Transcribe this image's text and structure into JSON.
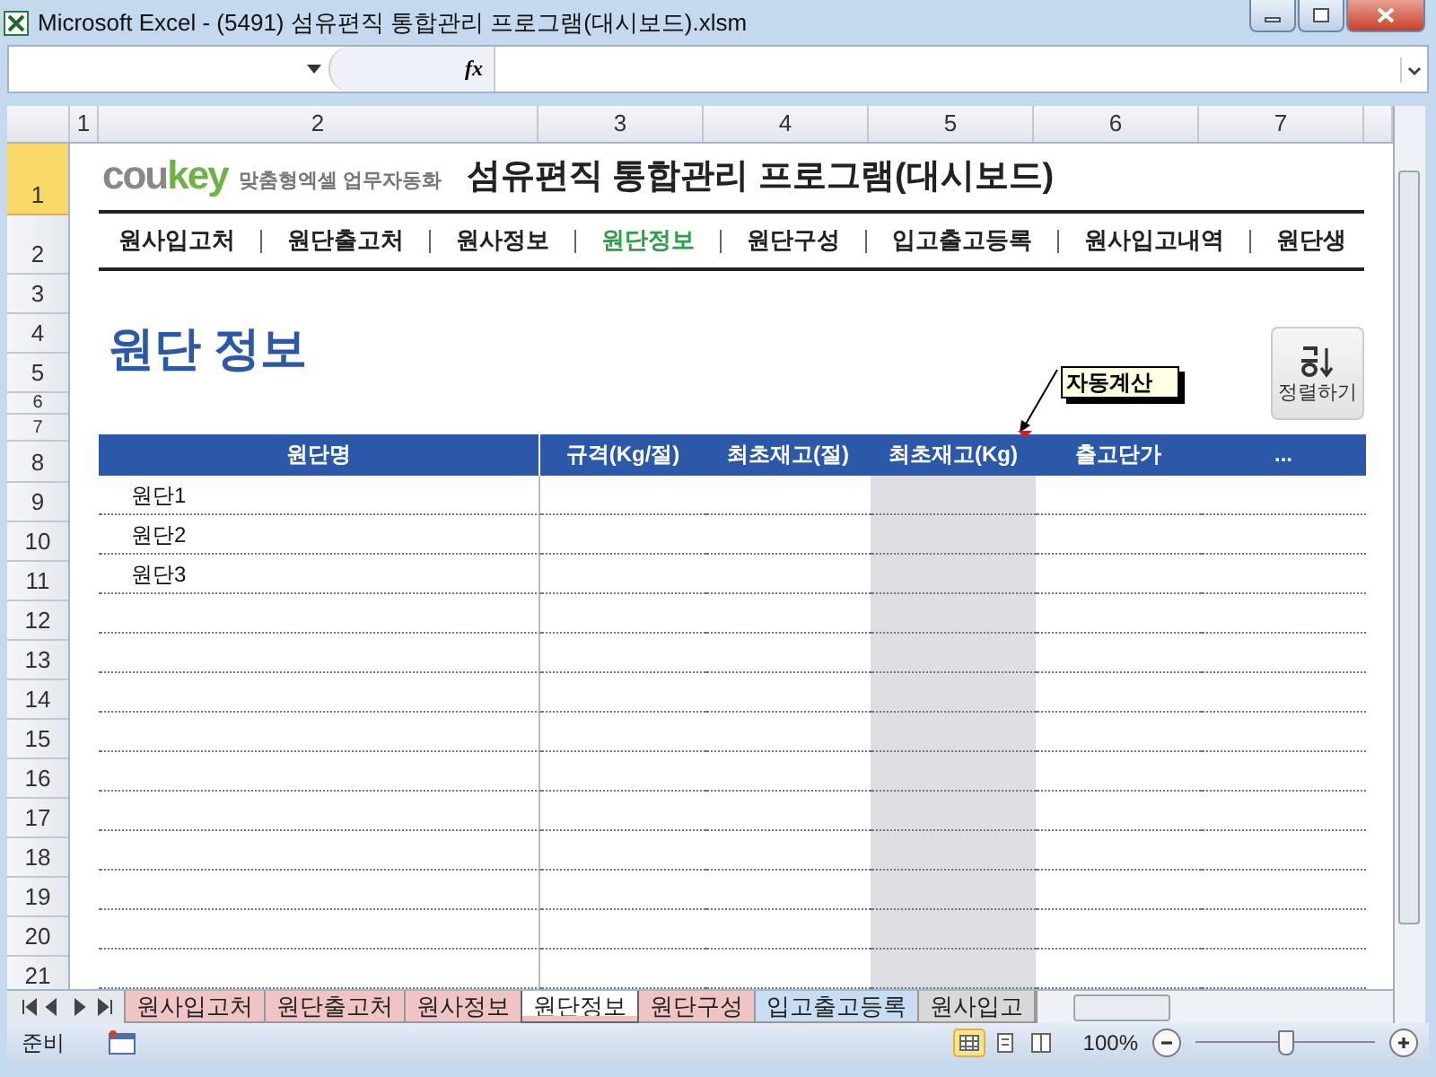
{
  "window": {
    "title": "Microsoft Excel - (5491) 섬유편직 통합관리 프로그램(대시보드).xlsm"
  },
  "formula_bar": {
    "fx": "fx"
  },
  "column_headers": [
    "1",
    "2",
    "3",
    "4",
    "5",
    "6",
    "7"
  ],
  "row_headers": [
    {
      "label": "1",
      "selected": true
    },
    {
      "label": "2",
      "selected": false
    },
    {
      "label": "3",
      "selected": false
    },
    {
      "label": "4",
      "selected": false
    },
    {
      "label": "5",
      "selected": false
    },
    {
      "label": "6",
      "selected": false
    },
    {
      "label": "7",
      "selected": false
    },
    {
      "label": "8",
      "selected": false
    },
    {
      "label": "9",
      "selected": false
    },
    {
      "label": "10",
      "selected": false
    },
    {
      "label": "11",
      "selected": false
    },
    {
      "label": "12",
      "selected": false
    },
    {
      "label": "13",
      "selected": false
    },
    {
      "label": "14",
      "selected": false
    },
    {
      "label": "15",
      "selected": false
    },
    {
      "label": "16",
      "selected": false
    },
    {
      "label": "17",
      "selected": false
    },
    {
      "label": "18",
      "selected": false
    },
    {
      "label": "19",
      "selected": false
    },
    {
      "label": "20",
      "selected": false
    },
    {
      "label": "21",
      "selected": false
    }
  ],
  "brand": {
    "logo_grey": "cou",
    "logo_green": "key",
    "tagline": "맞춤형엑셀 업무자동화",
    "title": "섬유편직 통합관리 프로그램(대시보드)"
  },
  "nav": [
    {
      "label": "원사입고처",
      "selected": false
    },
    {
      "label": "원단출고처",
      "selected": false
    },
    {
      "label": "원사정보",
      "selected": false
    },
    {
      "label": "원단정보",
      "selected": true
    },
    {
      "label": "원단구성",
      "selected": false
    },
    {
      "label": "입고출고등록",
      "selected": false
    },
    {
      "label": "원사입고내역",
      "selected": false
    },
    {
      "label": "원단생",
      "selected": false
    }
  ],
  "page_title": "원단 정보",
  "sort_button": {
    "label": "정렬하기"
  },
  "comment": "자동계산",
  "table": {
    "columns": [
      {
        "label": "원단명",
        "computed": false
      },
      {
        "label": "규격(Kg/절)",
        "computed": false
      },
      {
        "label": "최초재고(절)",
        "computed": false
      },
      {
        "label": "최초재고(Kg)",
        "computed": true
      },
      {
        "label": "출고단가",
        "computed": false
      },
      {
        "label": "...",
        "computed": false
      }
    ],
    "rows": [
      "원단1",
      "원단2",
      "원단3",
      "",
      "",
      "",
      "",
      "",
      "",
      "",
      "",
      "",
      ""
    ]
  },
  "sheet_tabs": [
    {
      "label": "원사입고처",
      "color": "#f0c4c4",
      "selected": false
    },
    {
      "label": "원단출고처",
      "color": "#f0c4c4",
      "selected": false
    },
    {
      "label": "원사정보",
      "color": "#f0c4c4",
      "selected": false
    },
    {
      "label": "원단정보",
      "color": "#f0c4c4",
      "selected": true
    },
    {
      "label": "원단구성",
      "color": "#f0c4c4",
      "selected": false
    },
    {
      "label": "입고출고등록",
      "color": "#c8dcf2",
      "selected": false
    },
    {
      "label": "원사입고",
      "color": "#d8d8d8",
      "selected": false
    }
  ],
  "status_bar": {
    "mode": "준비",
    "zoom": "100%",
    "level": 0.5,
    "views": [
      {
        "kind": "normal",
        "selected": true
      },
      {
        "kind": "layout",
        "selected": false
      },
      {
        "kind": "pagebreak",
        "selected": false
      }
    ]
  }
}
